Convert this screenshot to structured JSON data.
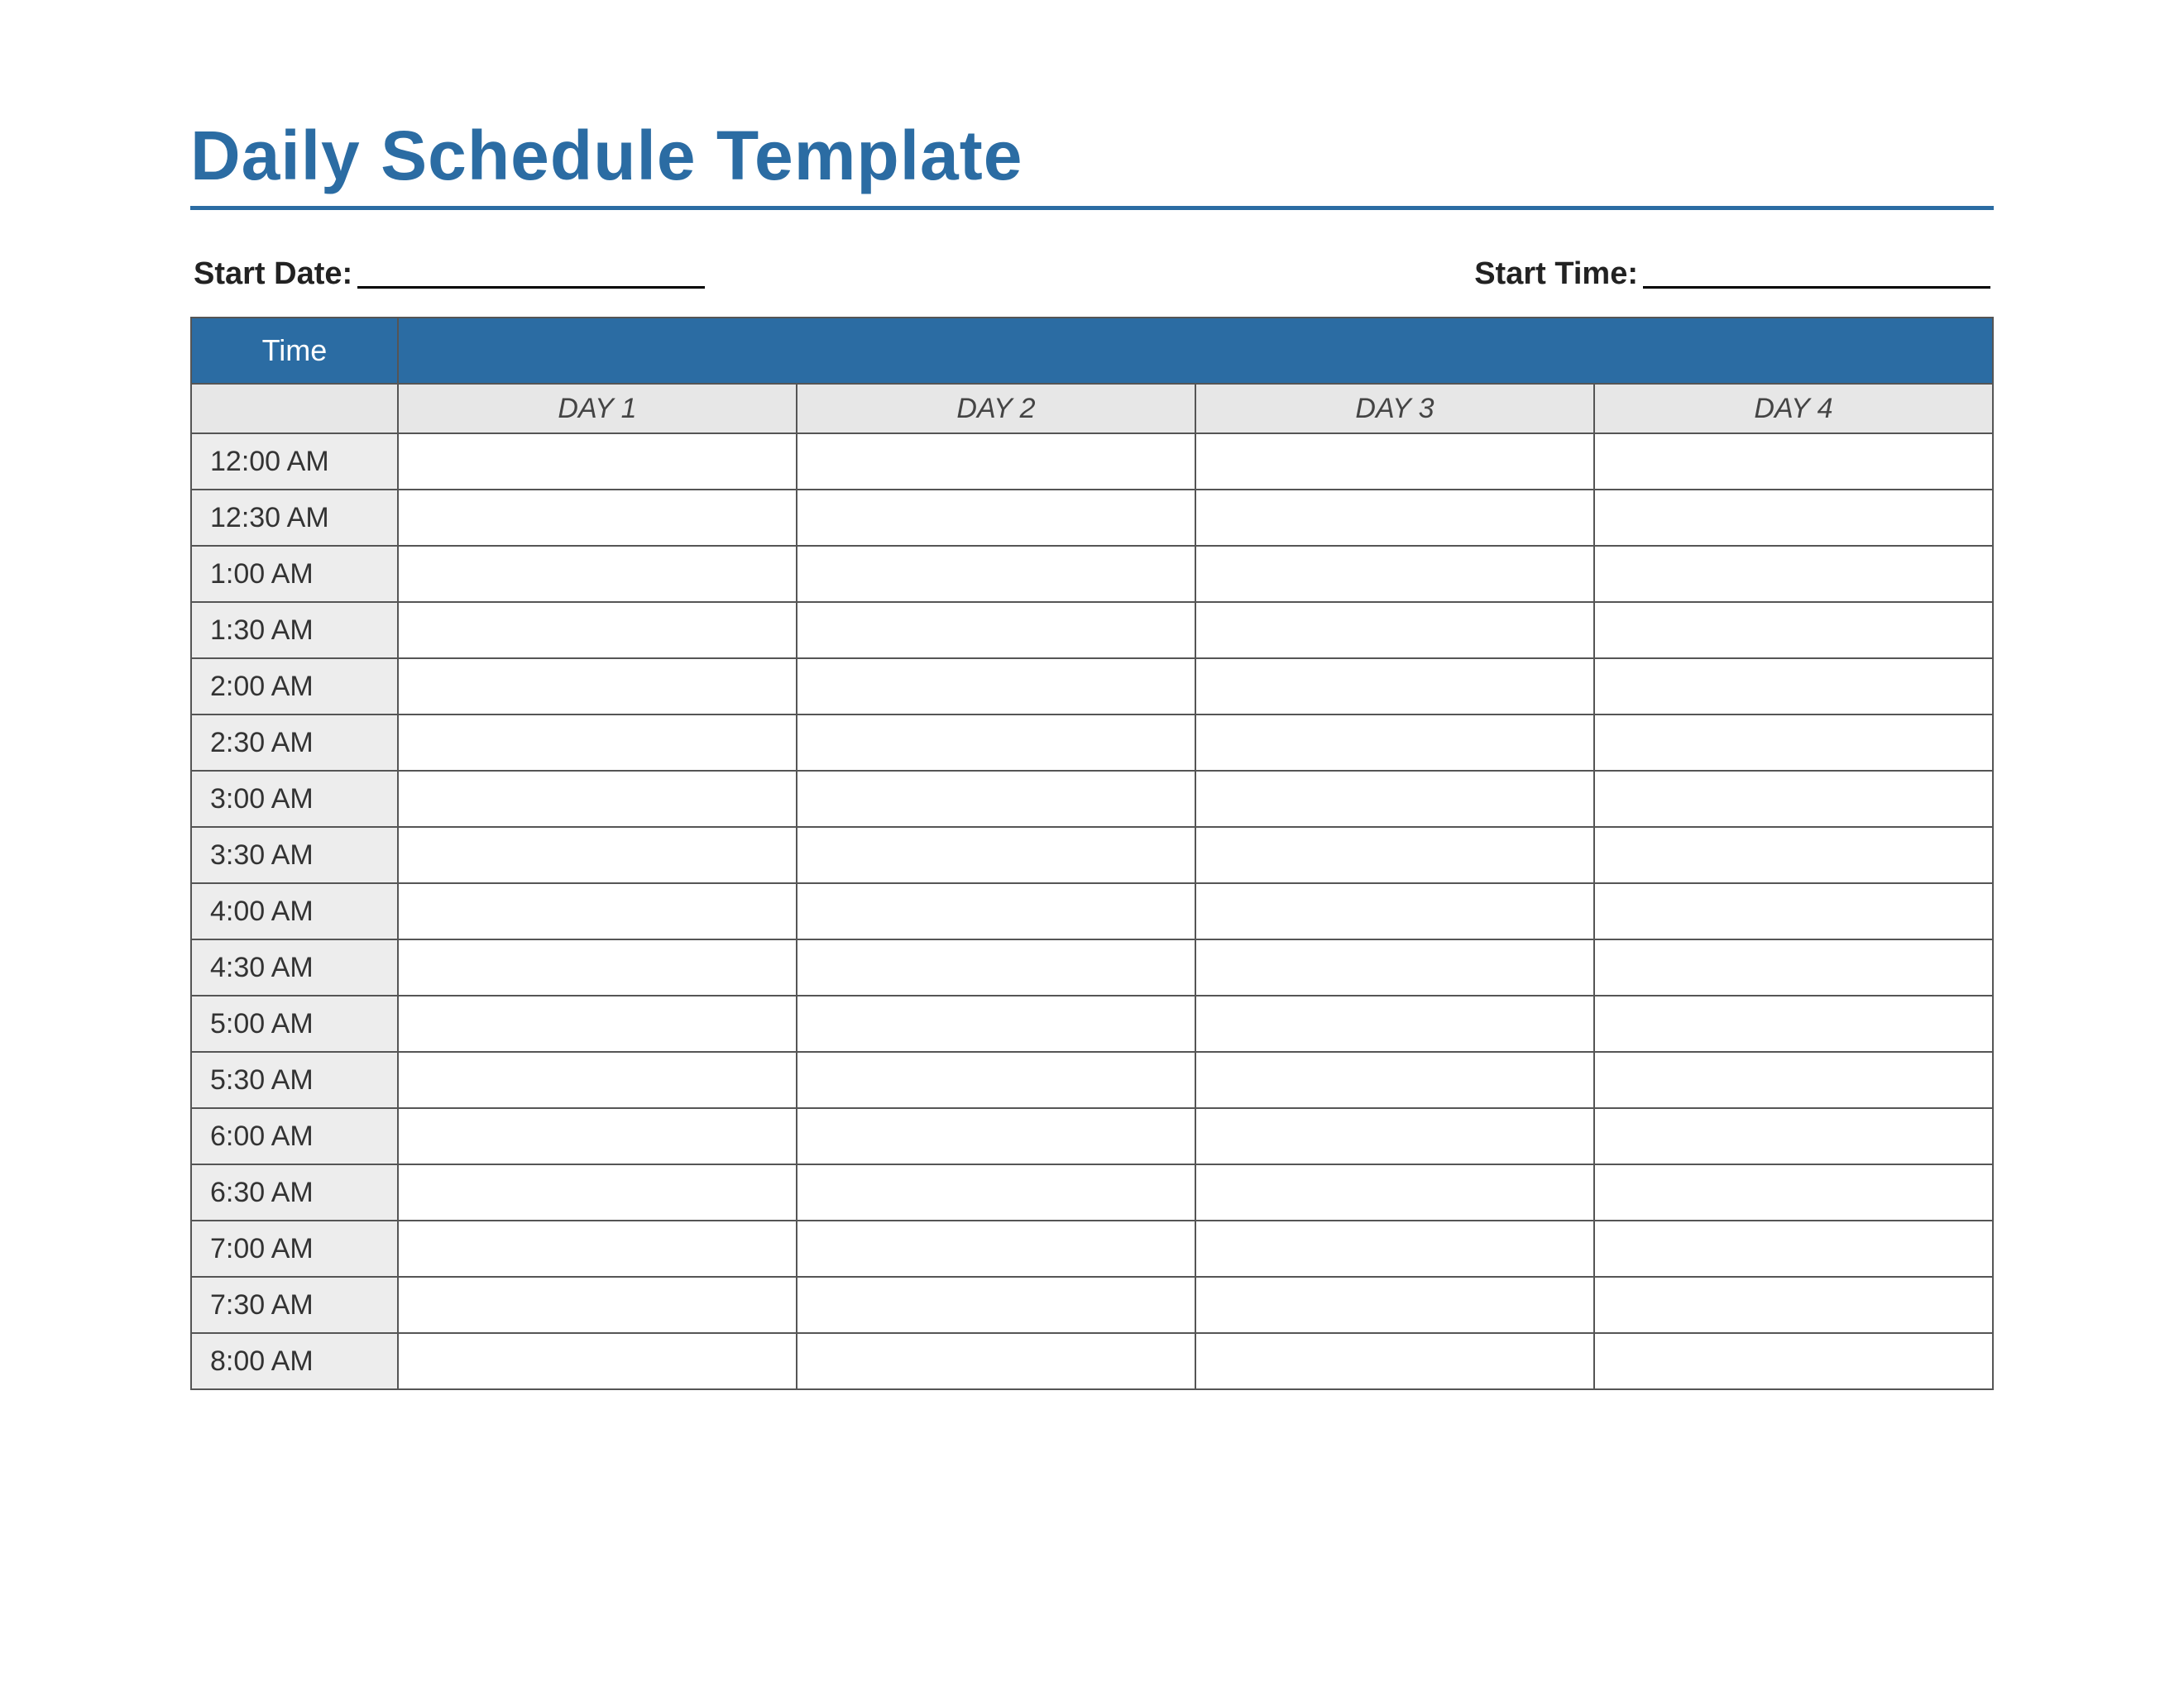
{
  "title": "Daily Schedule Template",
  "meta": {
    "start_date_label": "Start Date:",
    "start_date_value": "",
    "start_time_label": "Start Time:",
    "start_time_value": ""
  },
  "table": {
    "time_header": "Time",
    "blank_header": "",
    "days": [
      "DAY 1",
      "DAY 2",
      "DAY 3",
      "DAY 4"
    ],
    "rows": [
      {
        "time": "12:00 AM",
        "slots": [
          "",
          "",
          "",
          ""
        ]
      },
      {
        "time": "12:30 AM",
        "slots": [
          "",
          "",
          "",
          ""
        ]
      },
      {
        "time": "1:00 AM",
        "slots": [
          "",
          "",
          "",
          ""
        ]
      },
      {
        "time": "1:30 AM",
        "slots": [
          "",
          "",
          "",
          ""
        ]
      },
      {
        "time": "2:00 AM",
        "slots": [
          "",
          "",
          "",
          ""
        ]
      },
      {
        "time": "2:30 AM",
        "slots": [
          "",
          "",
          "",
          ""
        ]
      },
      {
        "time": "3:00 AM",
        "slots": [
          "",
          "",
          "",
          ""
        ]
      },
      {
        "time": "3:30 AM",
        "slots": [
          "",
          "",
          "",
          ""
        ]
      },
      {
        "time": "4:00 AM",
        "slots": [
          "",
          "",
          "",
          ""
        ]
      },
      {
        "time": "4:30 AM",
        "slots": [
          "",
          "",
          "",
          ""
        ]
      },
      {
        "time": "5:00 AM",
        "slots": [
          "",
          "",
          "",
          ""
        ]
      },
      {
        "time": "5:30 AM",
        "slots": [
          "",
          "",
          "",
          ""
        ]
      },
      {
        "time": "6:00 AM",
        "slots": [
          "",
          "",
          "",
          ""
        ]
      },
      {
        "time": "6:30 AM",
        "slots": [
          "",
          "",
          "",
          ""
        ]
      },
      {
        "time": "7:00 AM",
        "slots": [
          "",
          "",
          "",
          ""
        ]
      },
      {
        "time": "7:30 AM",
        "slots": [
          "",
          "",
          "",
          ""
        ]
      },
      {
        "time": "8:00 AM",
        "slots": [
          "",
          "",
          "",
          ""
        ]
      }
    ]
  }
}
